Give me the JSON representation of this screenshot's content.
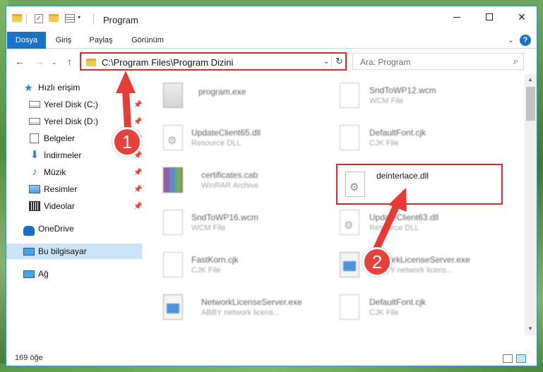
{
  "window": {
    "title": "Program",
    "controls": {
      "minimize": "",
      "maximize": "",
      "close": "✕"
    }
  },
  "ribbon": {
    "tabs": [
      "Dosya",
      "Giriş",
      "Paylaş",
      "Görünüm"
    ],
    "help": "?"
  },
  "address": {
    "path": "C:\\Program Files\\Program Dizini",
    "search_placeholder": "Ara: Program"
  },
  "sidebar": {
    "items": [
      {
        "label": "Hızlı erişim",
        "icon": "star-icon"
      },
      {
        "label": "Yerel Disk (C:)",
        "icon": "drive-icon",
        "pinned": true
      },
      {
        "label": "Yerel Disk (D:)",
        "icon": "drive-icon",
        "pinned": true
      },
      {
        "label": "Belgeler",
        "icon": "document-icon",
        "pinned": true
      },
      {
        "label": "İndirmeler",
        "icon": "download-icon",
        "pinned": true
      },
      {
        "label": "Müzik",
        "icon": "music-icon",
        "pinned": true
      },
      {
        "label": "Resimler",
        "icon": "picture-icon",
        "pinned": true
      },
      {
        "label": "Videolar",
        "icon": "video-icon",
        "pinned": true
      },
      {
        "label": "OneDrive",
        "icon": "cloud-icon"
      },
      {
        "label": "Bu bilgisayar",
        "icon": "computer-icon",
        "selected": true
      },
      {
        "label": "Ağ",
        "icon": "network-icon"
      }
    ]
  },
  "files": [
    {
      "name": "program.exe",
      "type": ""
    },
    {
      "name": "SndToWP12.wcm",
      "type": "WCM File"
    },
    {
      "name": "UpdateClient65.dll",
      "type": "Resource DLL"
    },
    {
      "name": "DefaultFont.cjk",
      "type": "CJK File"
    },
    {
      "name": "certificates.cab",
      "type": "WinRAR Archive"
    },
    {
      "name": "deinterlace.dll",
      "type": ""
    },
    {
      "name": "SndToWP16.wcm",
      "type": "WCM File"
    },
    {
      "name": "UpdateClient63.dll",
      "type": "Resource DLL"
    },
    {
      "name": "FastKorn.cjk",
      "type": "CJK File"
    },
    {
      "name": "NetworkLicenseServer.exe",
      "type": "ABBYY network licens..."
    },
    {
      "name": "NetworkLicenseServer.exe",
      "type": "ABBY network licens..."
    },
    {
      "name": "DefaultFont.cjk",
      "type": "CJK File"
    }
  ],
  "status": {
    "count": "169 öğe"
  },
  "annotations": {
    "badge1": "1",
    "badge2": "2",
    "color": "#e8403b"
  }
}
